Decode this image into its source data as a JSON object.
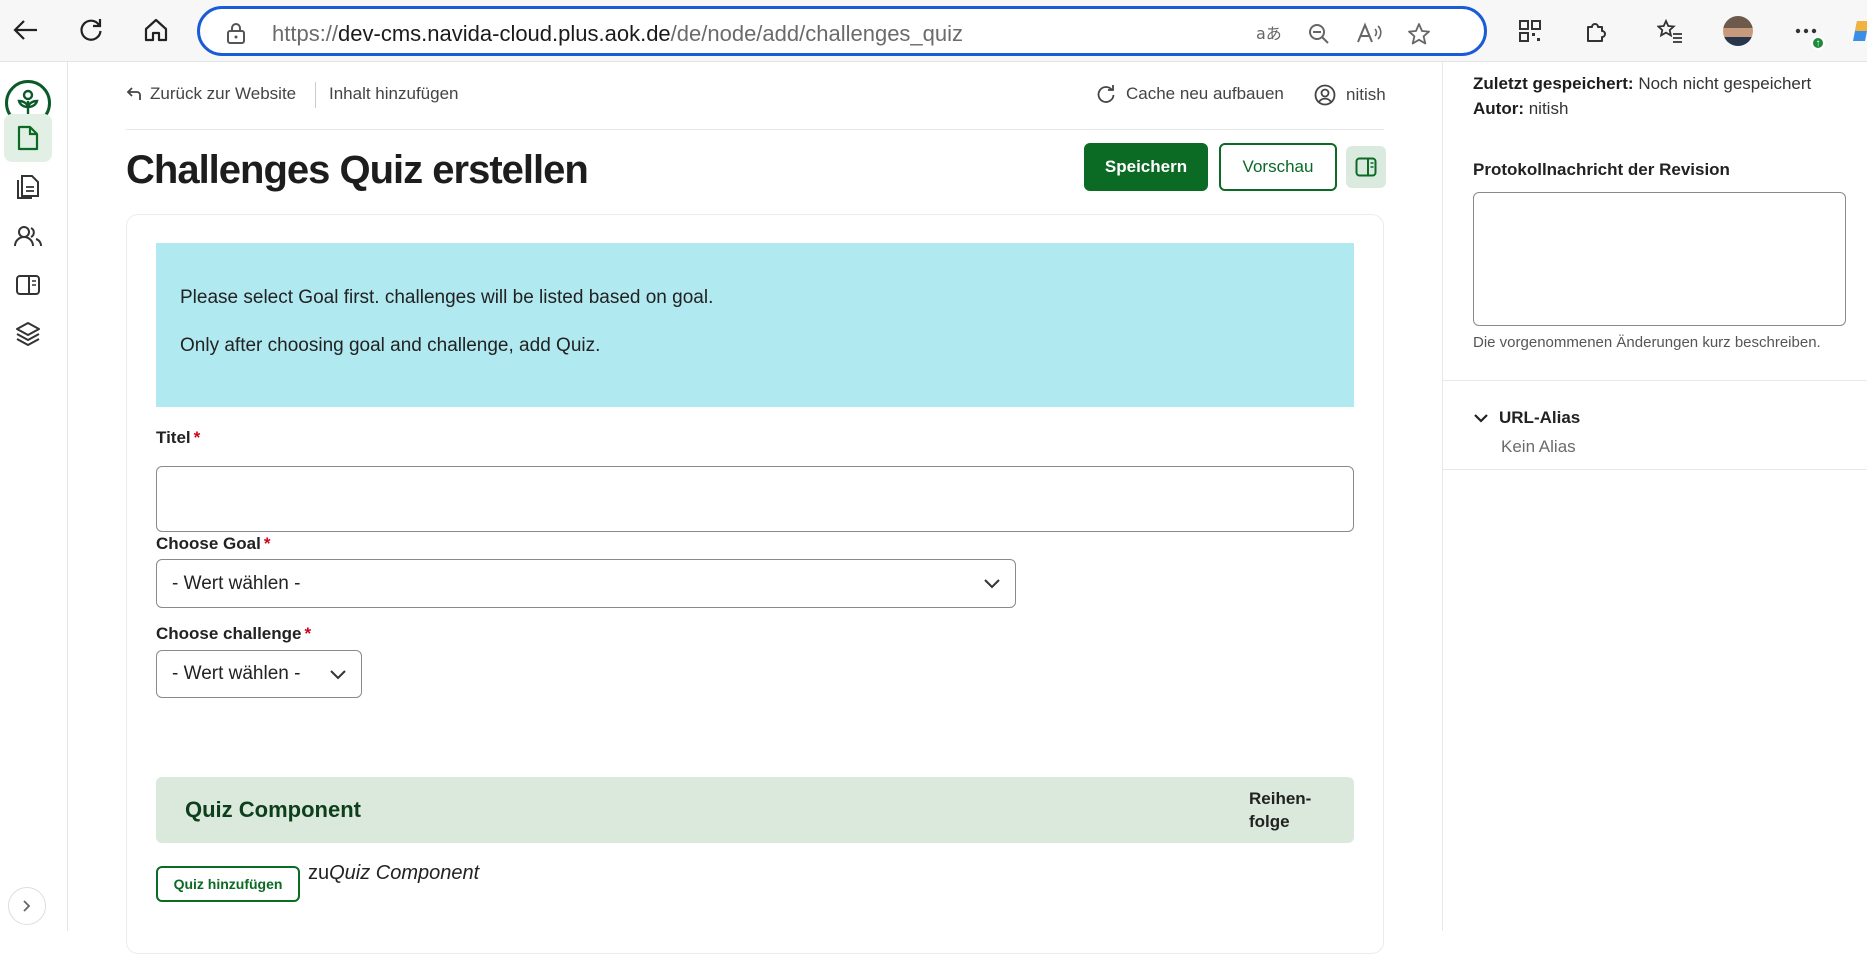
{
  "browser": {
    "url_scheme": "https://",
    "url_host": "dev-cms.navida-cloud.plus.aok.de",
    "url_path": "/de/node/add/challenges_quiz"
  },
  "topbar": {
    "back_label": "Zurück zur Website",
    "add_content_label": "Inhalt hinzufügen",
    "cache_label": "Cache neu aufbauen",
    "user_name": "nitish"
  },
  "page": {
    "title": "Challenges Quiz erstellen",
    "save_label": "Speichern",
    "preview_label": "Vorschau"
  },
  "info": {
    "line1": "Please select Goal first. challenges will be listed based on goal.",
    "line2": "Only after choosing goal and challenge, add Quiz."
  },
  "form": {
    "title_label": "Titel",
    "required_mark": "*",
    "title_value": "",
    "goal_label": "Choose Goal",
    "goal_value": "- Wert wählen -",
    "challenge_label": "Choose challenge",
    "challenge_value": "- Wert wählen -"
  },
  "quiz_component": {
    "title": "Quiz Component",
    "order_line1": "Reihen-",
    "order_line2": "folge",
    "add_button": "Quiz hinzufügen",
    "add_prefix": "zu",
    "add_target": "Quiz Component"
  },
  "sidebar_right": {
    "saved_label": "Zuletzt gespeichert:",
    "saved_value": "Noch nicht gespeichert",
    "author_label": "Autor:",
    "author_value": "nitish",
    "revision_label": "Protokollnachricht der Revision",
    "revision_value": "",
    "revision_desc": "Die vorgenommenen Änderungen kurz beschreiben.",
    "alias_label": "URL-Alias",
    "alias_value": "Kein Alias"
  },
  "colors": {
    "primary": "#0b6a24",
    "info_bg": "#b1e9f1",
    "component_bg": "#dbe9dc",
    "required": "#d0021b",
    "focus": "#1a5bd6"
  }
}
